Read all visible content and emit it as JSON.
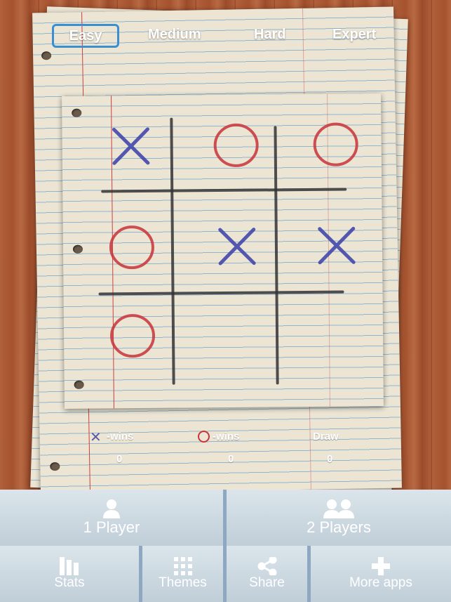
{
  "difficulty": {
    "options": [
      "Easy",
      "Medium",
      "Hard",
      "Expert"
    ],
    "selected": "Easy",
    "highlight_color": "#3a8fd0"
  },
  "board": {
    "cells": [
      [
        "X",
        "O",
        "O"
      ],
      [
        "O",
        "X",
        "X"
      ],
      [
        "O",
        "",
        ""
      ]
    ],
    "x_color": "#3a3fa8",
    "o_color": "#c8343a"
  },
  "scores": {
    "x_label": "-wins",
    "o_label": "-wins",
    "draw_label": "Draw",
    "x_wins": "0",
    "o_wins": "0",
    "draws": "0"
  },
  "modes": {
    "one_player": "1 Player",
    "two_players": "2 Players"
  },
  "menu": {
    "stats": "Stats",
    "themes": "Themes",
    "share": "Share",
    "more_apps": "More apps"
  }
}
